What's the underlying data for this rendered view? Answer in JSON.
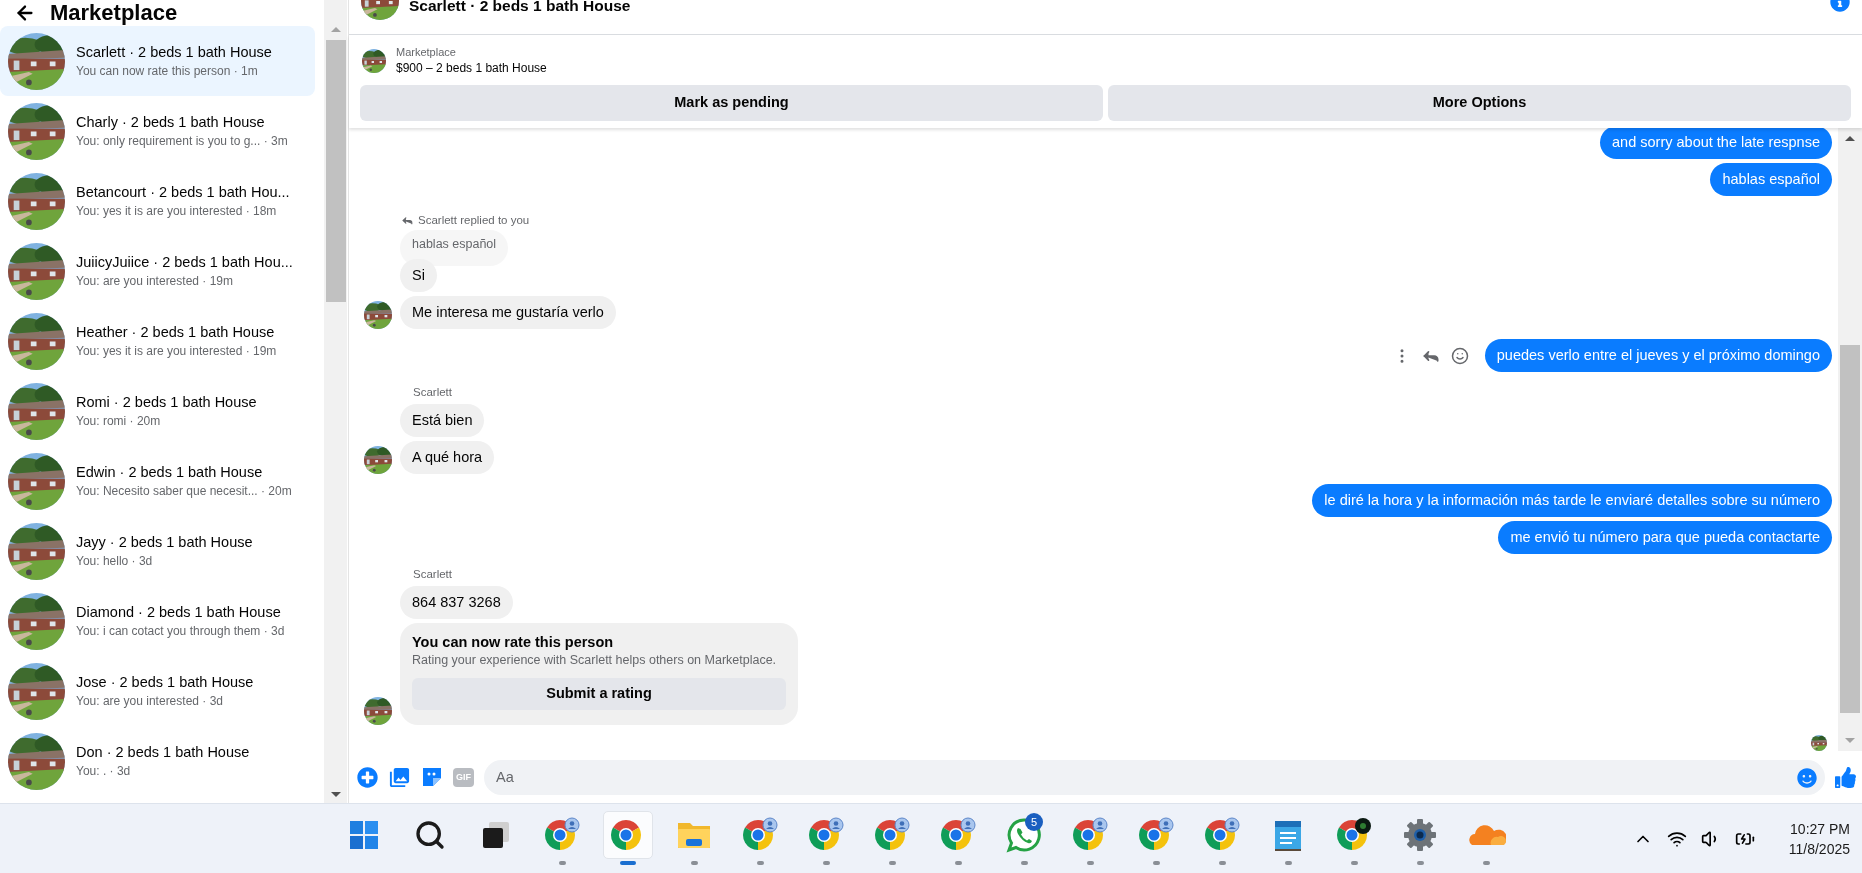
{
  "sidebar": {
    "title": "Marketplace",
    "conversations": [
      {
        "title": "Scarlett · 2 beds 1 bath House",
        "preview": "You can now rate this person · 1m",
        "selected": true
      },
      {
        "title": "Charly · 2 beds 1 bath House",
        "preview": "You: only requirement is you to g... · 3m",
        "selected": false
      },
      {
        "title": "Betancourt · 2 beds 1 bath Hou...",
        "preview": "You: yes it is are you interested · 18m",
        "selected": false
      },
      {
        "title": "JuiicyJuiice · 2 beds 1 bath Hou...",
        "preview": "You: are you interested · 19m",
        "selected": false
      },
      {
        "title": "Heather · 2 beds 1 bath House",
        "preview": "You: yes it is are you interested · 19m",
        "selected": false
      },
      {
        "title": "Romi · 2 beds 1 bath House",
        "preview": "You: romi · 20m",
        "selected": false
      },
      {
        "title": "Edwin · 2 beds 1 bath House",
        "preview": "You: Necesito saber que necesit... · 20m",
        "selected": false
      },
      {
        "title": "Jayy · 2 beds 1 bath House",
        "preview": "You: hello · 3d",
        "selected": false
      },
      {
        "title": "Diamond · 2 beds 1 bath House",
        "preview": "You: i can cotact you through them · 3d",
        "selected": false
      },
      {
        "title": "Jose · 2 beds 1 bath House",
        "preview": "You: are you interested · 3d",
        "selected": false
      },
      {
        "title": "Don · 2 beds 1 bath House",
        "preview": "You: . · 3d",
        "selected": false
      }
    ]
  },
  "chat": {
    "title": "Scarlett · 2 beds 1 bath House",
    "listing": {
      "source": "Marketplace",
      "title": "$900 – 2 beds 1 bath House"
    },
    "actions": [
      "Mark as pending",
      "More Options"
    ],
    "messages": [
      {
        "kind": "sent",
        "text": "and sorry about the late respnse",
        "hover_actions": false
      },
      {
        "kind": "sent",
        "text": "hablas español",
        "hover_actions": false
      },
      {
        "kind": "reply_note",
        "text": "Scarlett replied to you"
      },
      {
        "kind": "quote",
        "text": "hablas español"
      },
      {
        "kind": "received",
        "text": "Si",
        "avatar": false
      },
      {
        "kind": "received",
        "text": "Me interesa me gustaría verlo",
        "avatar": true
      },
      {
        "kind": "sent",
        "text": "puedes verlo entre el jueves y el próximo domingo",
        "hover_actions": true
      },
      {
        "kind": "sender",
        "text": "Scarlett"
      },
      {
        "kind": "received",
        "text": "Está bien",
        "avatar": false
      },
      {
        "kind": "received",
        "text": "A qué hora",
        "avatar": true
      },
      {
        "kind": "sent",
        "text": "le diré la hora y la información más tarde le enviaré detalles sobre su número",
        "hover_actions": false
      },
      {
        "kind": "sent",
        "text": "me envió tu número para que pueda contactarte",
        "hover_actions": false
      },
      {
        "kind": "sender",
        "text": "Scarlett"
      },
      {
        "kind": "received",
        "text": "864 837 3268",
        "avatar": false
      },
      {
        "kind": "rating_card",
        "title": "You can now rate this person",
        "body": "Rating your experience with Scarlett helps others on Marketplace.",
        "button": "Submit a rating",
        "avatar": true
      }
    ],
    "seen": true,
    "composer": {
      "gif": "GIF",
      "placeholder": "Aa"
    }
  },
  "taskbar": {
    "apps": [
      {
        "kind": "start",
        "running": false,
        "selected": false
      },
      {
        "kind": "search",
        "running": false,
        "selected": false
      },
      {
        "kind": "task_view",
        "running": false,
        "selected": false
      },
      {
        "kind": "chrome_profile",
        "running": true,
        "selected": false
      },
      {
        "kind": "chrome",
        "running": true,
        "selected": true
      },
      {
        "kind": "files",
        "running": true,
        "selected": false
      },
      {
        "kind": "chrome_profile",
        "running": true,
        "selected": false
      },
      {
        "kind": "chrome_profile",
        "running": true,
        "selected": false
      },
      {
        "kind": "chrome_profile",
        "running": true,
        "selected": false
      },
      {
        "kind": "chrome_profile",
        "running": true,
        "selected": false
      },
      {
        "kind": "whatsapp",
        "running": true,
        "selected": false,
        "badge": "5"
      },
      {
        "kind": "chrome_profile",
        "running": true,
        "selected": false
      },
      {
        "kind": "chrome_profile",
        "running": true,
        "selected": false
      },
      {
        "kind": "chrome_profile",
        "running": true,
        "selected": false
      },
      {
        "kind": "notepad",
        "running": true,
        "selected": false
      },
      {
        "kind": "chrome_extension",
        "running": true,
        "selected": false
      },
      {
        "kind": "settings",
        "running": true,
        "selected": false
      },
      {
        "kind": "cloud",
        "running": true,
        "selected": false
      }
    ],
    "clock": {
      "time": "10:27 PM",
      "date": "11/8/2025"
    }
  }
}
